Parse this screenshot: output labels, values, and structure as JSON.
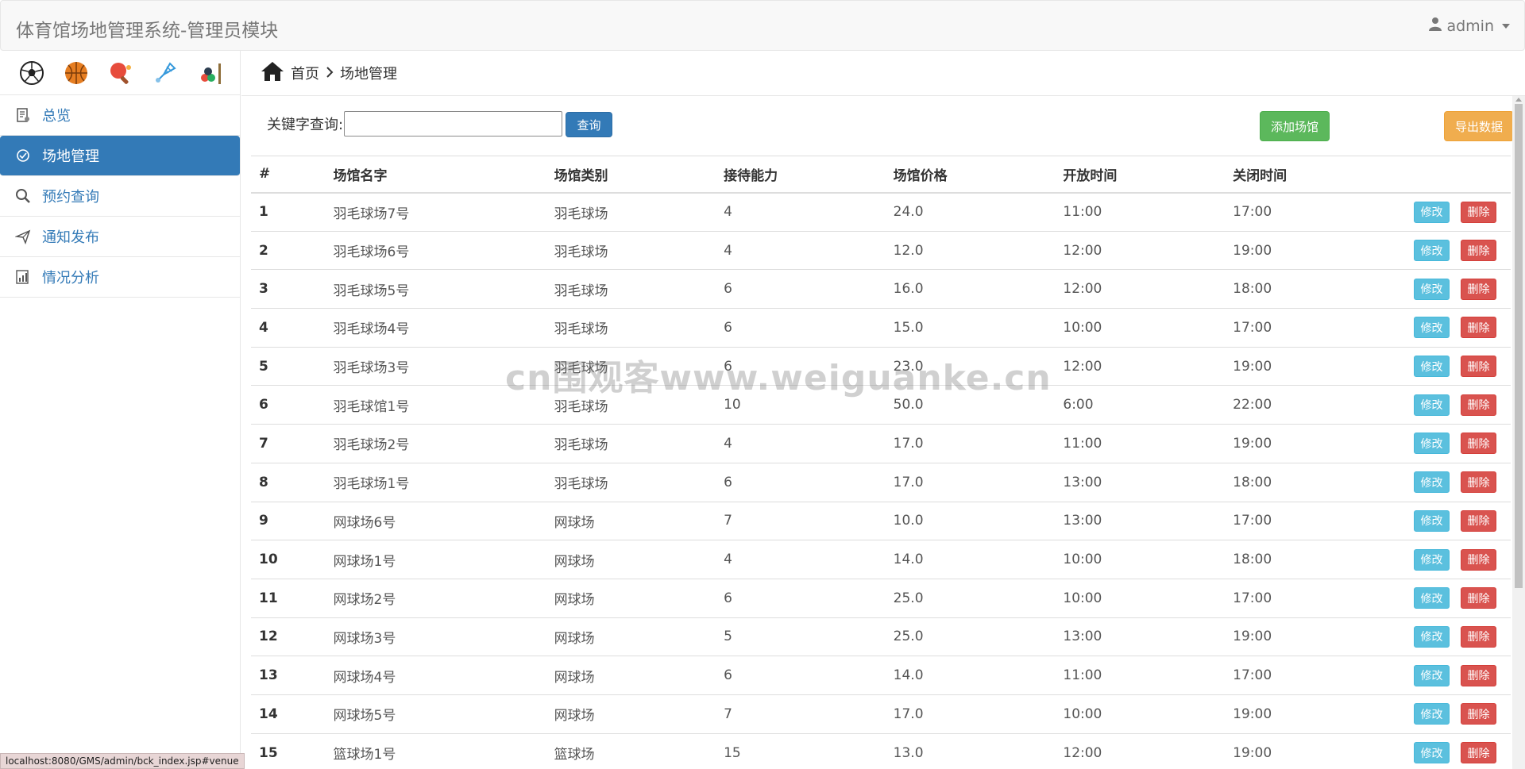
{
  "header": {
    "title": "体育馆场地管理系统-管理员模块",
    "user": "admin"
  },
  "sports": [
    {
      "icon": "soccer-ball-icon"
    },
    {
      "icon": "basketball-icon"
    },
    {
      "icon": "ping-pong-icon"
    },
    {
      "icon": "badminton-icon"
    },
    {
      "icon": "billiards-icon"
    }
  ],
  "sidebar": {
    "items": [
      {
        "label": "总览",
        "icon": "overview-icon"
      },
      {
        "label": "场地管理",
        "icon": "venue-icon",
        "active": true
      },
      {
        "label": "预约查询",
        "icon": "search-icon"
      },
      {
        "label": "通知发布",
        "icon": "send-icon"
      },
      {
        "label": "情况分析",
        "icon": "analysis-icon"
      }
    ]
  },
  "breadcrumb": {
    "home": "首页",
    "current": "场地管理"
  },
  "toolbar": {
    "keyword_label": "关键字查询:",
    "keyword_value": "",
    "search_label": "查询",
    "add_label": "添加场馆",
    "export_label": "导出数据"
  },
  "table": {
    "headers": [
      "#",
      "场馆名字",
      "场馆类别",
      "接待能力",
      "场馆价格",
      "开放时间",
      "关闭时间"
    ],
    "edit_label": "修改",
    "delete_label": "删除",
    "rows": [
      [
        "1",
        "羽毛球场7号",
        "羽毛球场",
        "4",
        "24.0",
        "11:00",
        "17:00"
      ],
      [
        "2",
        "羽毛球场6号",
        "羽毛球场",
        "4",
        "12.0",
        "12:00",
        "19:00"
      ],
      [
        "3",
        "羽毛球场5号",
        "羽毛球场",
        "6",
        "16.0",
        "12:00",
        "18:00"
      ],
      [
        "4",
        "羽毛球场4号",
        "羽毛球场",
        "6",
        "15.0",
        "10:00",
        "17:00"
      ],
      [
        "5",
        "羽毛球场3号",
        "羽毛球场",
        "6",
        "23.0",
        "12:00",
        "19:00"
      ],
      [
        "6",
        "羽毛球馆1号",
        "羽毛球场",
        "10",
        "50.0",
        "6:00",
        "22:00"
      ],
      [
        "7",
        "羽毛球场2号",
        "羽毛球场",
        "4",
        "17.0",
        "11:00",
        "19:00"
      ],
      [
        "8",
        "羽毛球场1号",
        "羽毛球场",
        "6",
        "17.0",
        "13:00",
        "18:00"
      ],
      [
        "9",
        "网球场6号",
        "网球场",
        "7",
        "10.0",
        "13:00",
        "17:00"
      ],
      [
        "10",
        "网球场1号",
        "网球场",
        "4",
        "14.0",
        "10:00",
        "18:00"
      ],
      [
        "11",
        "网球场2号",
        "网球场",
        "6",
        "25.0",
        "10:00",
        "17:00"
      ],
      [
        "12",
        "网球场3号",
        "网球场",
        "5",
        "25.0",
        "13:00",
        "19:00"
      ],
      [
        "13",
        "网球场4号",
        "网球场",
        "6",
        "14.0",
        "11:00",
        "17:00"
      ],
      [
        "14",
        "网球场5号",
        "网球场",
        "7",
        "17.0",
        "10:00",
        "19:00"
      ],
      [
        "15",
        "篮球场1号",
        "篮球场",
        "15",
        "13.0",
        "12:00",
        "19:00"
      ]
    ]
  },
  "watermark": "cn围观客www.weiguanke.cn",
  "status_url": "localhost:8080/GMS/admin/bck_index.jsp#venue",
  "colors": {
    "primary": "#337ab7",
    "success": "#5cb85c",
    "warning": "#f0ad4e",
    "info": "#5bc0de",
    "danger": "#d9534f"
  }
}
